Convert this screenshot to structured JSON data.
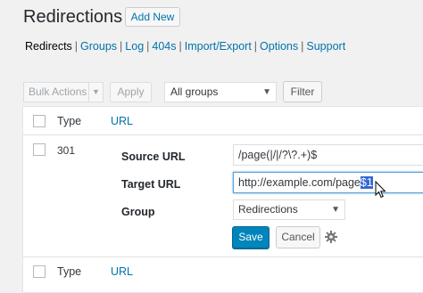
{
  "header": {
    "title": "Redirections",
    "add_new_label": "Add New"
  },
  "nav": {
    "items": [
      {
        "label": "Redirects",
        "current": true
      },
      {
        "label": "Groups"
      },
      {
        "label": "Log"
      },
      {
        "label": "404s"
      },
      {
        "label": "Import/Export"
      },
      {
        "label": "Options"
      },
      {
        "label": "Support"
      }
    ],
    "separator": "|"
  },
  "toolbar": {
    "bulk_actions_label": "Bulk Actions",
    "apply_label": "Apply",
    "groups_select_value": "All groups",
    "filter_label": "Filter"
  },
  "table": {
    "columns": {
      "type": "Type",
      "url": "URL"
    },
    "row": {
      "code": "301",
      "source_url_label": "Source URL",
      "source_url_value": "/page(|/|/?\\?.+)$",
      "target_url_label": "Target URL",
      "target_url_prefix": "http://example.com/page",
      "target_url_selected": "$1",
      "group_label": "Group",
      "group_value": "Redirections",
      "save_label": "Save",
      "cancel_label": "Cancel"
    }
  },
  "icons": {
    "dropdown": "chevron-down-icon",
    "settings": "gear-icon",
    "cursor": "text-cursor-icon"
  },
  "colors": {
    "accent": "#0073aa",
    "primary_button": "#0085ba",
    "selection": "#3367d6"
  }
}
